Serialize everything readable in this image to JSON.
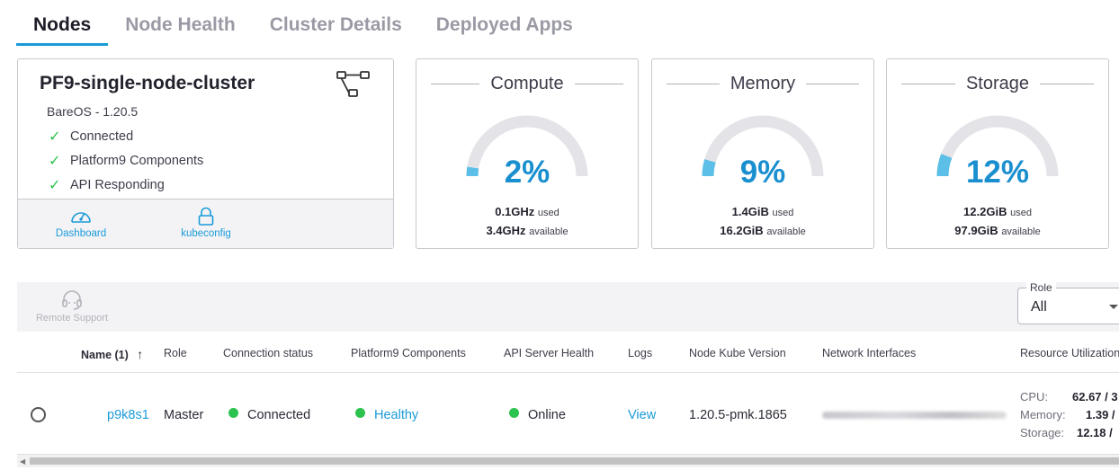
{
  "tabs": [
    {
      "label": "Nodes",
      "active": true
    },
    {
      "label": "Node Health",
      "active": false
    },
    {
      "label": "Cluster Details",
      "active": false
    },
    {
      "label": "Deployed Apps",
      "active": false
    }
  ],
  "cluster": {
    "name": "PF9-single-node-cluster",
    "os": "BareOS - 1.20.5",
    "checks": [
      "Connected",
      "Platform9 Components",
      "API Responding"
    ],
    "links": {
      "dashboard": "Dashboard",
      "kubeconfig": "kubeconfig"
    }
  },
  "gauges": [
    {
      "title": "Compute",
      "percent": "2%",
      "fraction": 0.02,
      "used_value": "0.1GHz",
      "used_label": "used",
      "available_value": "3.4GHz",
      "available_label": "available"
    },
    {
      "title": "Memory",
      "percent": "9%",
      "fraction": 0.09,
      "used_value": "1.4GiB",
      "used_label": "used",
      "available_value": "16.2GiB",
      "available_label": "available"
    },
    {
      "title": "Storage",
      "percent": "12%",
      "fraction": 0.12,
      "used_value": "12.2GiB",
      "used_label": "used",
      "available_value": "97.9GiB",
      "available_label": "available"
    }
  ],
  "toolbar": {
    "remote_support": "Remote Support",
    "role_label": "Role",
    "role_value": "All"
  },
  "table": {
    "headers": {
      "name": "Name (1)",
      "role": "Role",
      "connection": "Connection status",
      "components": "Platform9 Components",
      "api_health": "API Server Health",
      "logs": "Logs",
      "kube_version": "Node Kube Version",
      "network": "Network Interfaces",
      "resource": "Resource Utilization"
    },
    "rows": [
      {
        "name": "p9k8s1",
        "role": "Master",
        "connection": "Connected",
        "components": "Healthy",
        "api_health": "Online",
        "logs": "View",
        "kube_version": "1.20.5-pmk.1865",
        "cpu_label": "CPU:",
        "cpu_value": "62.67 / 3",
        "memory_label": "Memory:",
        "memory_value": "1.39 /",
        "storage_label": "Storage:",
        "storage_value": "12.18 /"
      }
    ]
  },
  "colors": {
    "accent": "#1a9bd8",
    "ok": "#2cc24f",
    "gauge_fill": "#5bbfe8",
    "gauge_track": "#e4e4e8"
  }
}
